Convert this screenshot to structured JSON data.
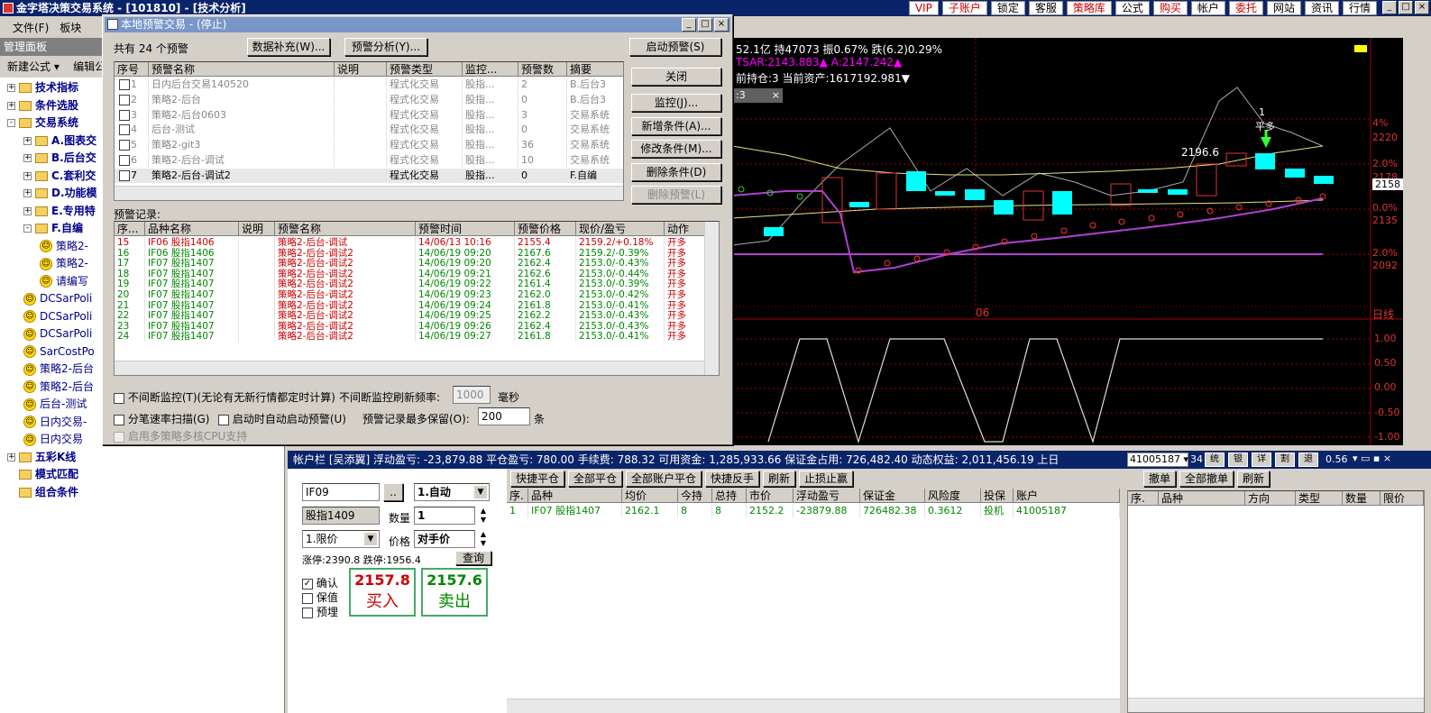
{
  "app": {
    "title": "金字塔决策交易系统 - [101810] - [技术分析]"
  },
  "topnav": [
    {
      "label": "VIP",
      "red": true
    },
    {
      "label": "子账户",
      "red": true
    },
    {
      "label": "锁定",
      "red": false
    },
    {
      "label": "客服",
      "red": false
    },
    {
      "label": "策略库",
      "red": true
    },
    {
      "label": "公式",
      "red": false
    },
    {
      "label": "购买",
      "red": true
    },
    {
      "label": "帐户",
      "red": false
    },
    {
      "label": "委托",
      "red": true
    },
    {
      "label": "网站",
      "red": false
    },
    {
      "label": "资讯",
      "red": false
    },
    {
      "label": "行情",
      "red": false
    }
  ],
  "menu": [
    "文件(F)",
    "板块"
  ],
  "leftpanel": {
    "title": "管理面板",
    "new_formula": "新建公式 ▾",
    "edit_formula": "编辑公"
  },
  "tree": [
    {
      "label": "技术指标",
      "level": 0,
      "type": "folder",
      "exp": "+",
      "bold": true
    },
    {
      "label": "条件选股",
      "level": 0,
      "type": "folder",
      "exp": "+",
      "bold": true
    },
    {
      "label": "交易系统",
      "level": 0,
      "type": "folder",
      "exp": "-",
      "bold": true
    },
    {
      "label": "A.图表交",
      "level": 1,
      "type": "folder",
      "exp": "+",
      "bold": true
    },
    {
      "label": "B.后台交",
      "level": 1,
      "type": "folder",
      "exp": "+",
      "bold": true
    },
    {
      "label": "C.套利交",
      "level": 1,
      "type": "folder",
      "exp": "+",
      "bold": true
    },
    {
      "label": "D.功能模",
      "level": 1,
      "type": "folder",
      "exp": "+",
      "bold": true
    },
    {
      "label": "E.专用特",
      "level": 1,
      "type": "folder",
      "exp": "+",
      "bold": true
    },
    {
      "label": "F.自编",
      "level": 1,
      "type": "folder",
      "exp": "-",
      "bold": true
    },
    {
      "label": "策略2-",
      "level": 2,
      "type": "smile",
      "bold": false
    },
    {
      "label": "策略2-",
      "level": 2,
      "type": "smile",
      "bold": false
    },
    {
      "label": "请编写",
      "level": 2,
      "type": "smile",
      "bold": false
    },
    {
      "label": "DCSarPoli",
      "level": 1,
      "type": "smile",
      "bold": false
    },
    {
      "label": "DCSarPoli",
      "level": 1,
      "type": "smile",
      "bold": false
    },
    {
      "label": "DCSarPoli",
      "level": 1,
      "type": "smile",
      "bold": false
    },
    {
      "label": "SarCostPo",
      "level": 1,
      "type": "smile",
      "bold": false
    },
    {
      "label": "策略2-后台",
      "level": 1,
      "type": "smile",
      "bold": false
    },
    {
      "label": "策略2-后台",
      "level": 1,
      "type": "smile",
      "bold": false
    },
    {
      "label": "后台-测试",
      "level": 1,
      "type": "smile",
      "bold": false
    },
    {
      "label": "日内交易-",
      "level": 1,
      "type": "smile",
      "bold": false
    },
    {
      "label": "日内交易",
      "level": 1,
      "type": "smile",
      "bold": false
    },
    {
      "label": "五彩K线",
      "level": 0,
      "type": "folder",
      "exp": "+",
      "bold": true
    },
    {
      "label": "模式匹配",
      "level": 0,
      "type": "folder",
      "exp": "",
      "bold": true
    },
    {
      "label": "组合条件",
      "level": 0,
      "type": "folder",
      "exp": "",
      "bold": true
    }
  ],
  "chart": {
    "info1": "52.1亿 持47073 振0.67% 跌(6.2)0.29%",
    "info2": "TSAR:2143.883▲ A:2147.242▲",
    "info3": "前持仓:3 当前资产:1617192.981▼",
    "label_2196": "2196.6",
    "label_pc": "平多",
    "label_1": "1",
    "xlabel": "06",
    "period": "日线",
    "right_scale": [
      "4%",
      "2220",
      "2.0%",
      "2178",
      "2158",
      "0.0%",
      "2135",
      "2.0%",
      "2092"
    ],
    "ind_scale": [
      "1.00",
      "0.50",
      "0.00",
      "-0.50",
      "-1.00"
    ]
  },
  "dialog": {
    "title": "本地预警交易 - (停止)",
    "count": "共有 24 个预警",
    "btn_supplement": "数据补充(W)...",
    "btn_analysis": "预警分析(Y)...",
    "btn_start": "启动预警(S)",
    "btn_close": "关闭",
    "btn_monitor": "监控(J)...",
    "btn_add": "新增条件(A)...",
    "btn_modify": "修改条件(M)...",
    "btn_delete": "删除条件(D)",
    "btn_delete_alert": "删除预警(L)",
    "alert_headers": [
      "序号",
      "预警名称",
      "说明",
      "预警类型",
      "监控...",
      "预警数",
      "摘要"
    ],
    "alerts": [
      [
        "1",
        "日内后台交易140520",
        "",
        "程式化交易",
        "股指...",
        "2",
        "B.后台3"
      ],
      [
        "2",
        "策略2-后台",
        "",
        "程式化交易",
        "股指...",
        "0",
        "B.后台3"
      ],
      [
        "3",
        "策略2-后台0603",
        "",
        "程式化交易",
        "股指...",
        "3",
        "交易系统"
      ],
      [
        "4",
        "后台-测试",
        "",
        "程式化交易",
        "股指...",
        "0",
        "交易系统"
      ],
      [
        "5",
        "策略2-git3",
        "",
        "程式化交易",
        "股指...",
        "36",
        "交易系统"
      ],
      [
        "6",
        "策略2-后台-调试",
        "",
        "程式化交易",
        "股指...",
        "10",
        "交易系统"
      ],
      [
        "7",
        "策略2-后台-调试2",
        "",
        "程式化交易",
        "股指...",
        "0",
        "F.自编"
      ]
    ],
    "record_label": "预警记录:",
    "record_headers": [
      "序...",
      "品种名称",
      "说明",
      "预警名称",
      "预警时间",
      "预警价格",
      "现价/盈亏",
      "动作"
    ],
    "records": [
      [
        "15",
        "IF06 股指1406",
        "",
        "策略2-后台-调试",
        "14/06/13 10:16",
        "2155.4",
        "2159.2/+0.18%",
        "开多"
      ],
      [
        "16",
        "IF06 股指1406",
        "",
        "策略2-后台-调试2",
        "14/06/19 09:20",
        "2167.6",
        "2159.2/-0.39%",
        "开多"
      ],
      [
        "17",
        "IF07 股指1407",
        "",
        "策略2-后台-调试2",
        "14/06/19 09:20",
        "2162.4",
        "2153.0/-0.43%",
        "开多"
      ],
      [
        "18",
        "IF07 股指1407",
        "",
        "策略2-后台-调试2",
        "14/06/19 09:21",
        "2162.6",
        "2153.0/-0.44%",
        "开多"
      ],
      [
        "19",
        "IF07 股指1407",
        "",
        "策略2-后台-调试2",
        "14/06/19 09:22",
        "2161.4",
        "2153.0/-0.39%",
        "开多"
      ],
      [
        "20",
        "IF07 股指1407",
        "",
        "策略2-后台-调试2",
        "14/06/19 09:23",
        "2162.0",
        "2153.0/-0.42%",
        "开多"
      ],
      [
        "21",
        "IF07 股指1407",
        "",
        "策略2-后台-调试2",
        "14/06/19 09:24",
        "2161.8",
        "2153.0/-0.41%",
        "开多"
      ],
      [
        "22",
        "IF07 股指1407",
        "",
        "策略2-后台-调试2",
        "14/06/19 09:25",
        "2162.2",
        "2153.0/-0.43%",
        "开多"
      ],
      [
        "23",
        "IF07 股指1407",
        "",
        "策略2-后台-调试2",
        "14/06/19 09:26",
        "2162.4",
        "2153.0/-0.43%",
        "开多"
      ],
      [
        "24",
        "IF07 股指1407",
        "",
        "策略2-后台-调试2",
        "14/06/19 09:27",
        "2161.8",
        "2153.0/-0.41%",
        "开多"
      ]
    ],
    "opt_continuous": "不间断监控(T)(无论有无新行情都定时计算)",
    "opt_refresh_label": "不间断监控刷新频率:",
    "opt_refresh_value": "1000",
    "opt_refresh_unit": "毫秒",
    "opt_tick": "分笔速率扫描(G)",
    "opt_autostart": "启动时自动启动预警(U)",
    "opt_keep_label": "预警记录最多保留(O):",
    "opt_keep_value": "200",
    "opt_keep_unit": "条",
    "opt_cpu": "启用多策略多核CPU支持"
  },
  "acct": {
    "text": "帐户栏 [吴添翼]  浮动盈亏: -23,879.88   平仓盈亏: 780.00   手续费: 788.32   可用资金: 1,285,933.66   保证金占用: 726,482.40   动态权益: 2,011,456.19   上日",
    "account": "41005187 ▾",
    "num": "34",
    "btns": [
      "统",
      "银",
      "详",
      "割",
      "退"
    ],
    "tail": "0.56"
  },
  "trade": {
    "code": "IF09",
    "dots": "..",
    "mode": "1.自动",
    "name": "股指1409",
    "qty_label": "数量",
    "qty": "1",
    "ptype": "1.限价",
    "price_label": "价格",
    "price": "对手价",
    "limits": "涨停:2390.8 跌停:1956.4",
    "query": "查询",
    "chk_confirm": "确认",
    "chk_hedge": "保值",
    "chk_prebuy": "预埋",
    "buy_price": "2157.8",
    "buy_label": "买入",
    "sell_price": "2157.6",
    "sell_label": "卖出"
  },
  "positions": {
    "btns": [
      "快捷平仓",
      "全部平仓",
      "全部账户平仓",
      "快捷反手",
      "刷新",
      "止损止赢"
    ],
    "headers": [
      "序.",
      "品种",
      "均价",
      "今持",
      "总持",
      "市价",
      "浮动盈亏",
      "保证金",
      "风险度",
      "投保",
      "账户"
    ],
    "rows": [
      [
        "1",
        "IF07 股指1407",
        "2162.1",
        "8",
        "8",
        "2152.2",
        "-23879.88",
        "726482.38",
        "0.3612",
        "投机",
        "41005187"
      ]
    ]
  },
  "orders": {
    "btns": [
      "撤单",
      "全部撤单",
      "刷新"
    ],
    "headers": [
      "序.",
      "品种",
      "方向",
      "类型",
      "数量",
      "限价"
    ]
  }
}
